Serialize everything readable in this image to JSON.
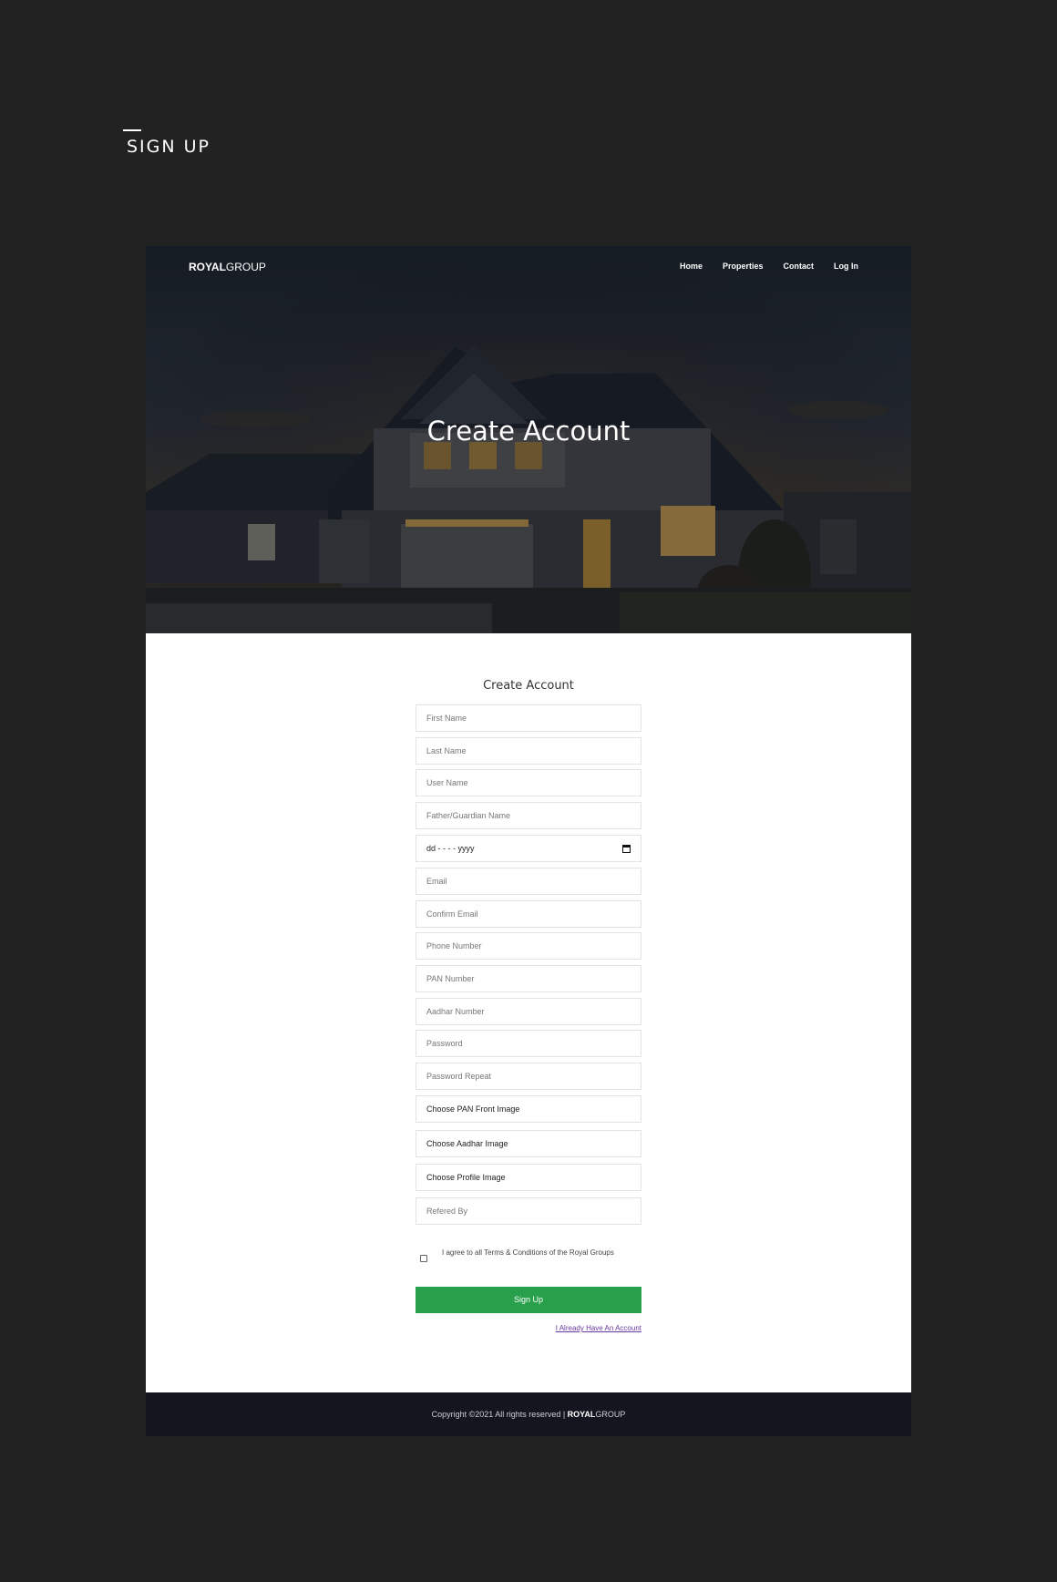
{
  "page_heading": "SIGN UP",
  "navbar": {
    "logo_bold": "ROYAL",
    "logo_light": "GROUP",
    "links": [
      "Home",
      "Properties",
      "Contact",
      "Log In"
    ]
  },
  "hero": {
    "title": "Create Account"
  },
  "form": {
    "title": "Create Account",
    "fields": {
      "first_name": "First Name",
      "last_name": "Last Name",
      "user_name": "User Name",
      "guardian_name": "Father/Guardian Name",
      "dob": "dd - - - - yyyy",
      "email": "Email",
      "confirm_email": "Confirm Email",
      "phone": "Phone Number",
      "pan": "PAN Number",
      "aadhar": "Aadhar Number",
      "password": "Password",
      "password_repeat": "Password Repeat",
      "pan_image": "Choose PAN Front Image",
      "aadhar_image": "Choose Aadhar Image",
      "profile_image": "Choose Profile Image",
      "referred_by": "Refered By"
    },
    "terms": "I agree to all Terms & Conditions of the Royal Groups",
    "submit": "Sign Up",
    "login_link": "I Already Have An Account"
  },
  "footer": {
    "text": "Copyright ©2021 All rights reserved | ",
    "brand_bold": "ROYAL",
    "brand_light": "GROUP"
  },
  "colors": {
    "page_bg": "#222222",
    "button": "#28a04b",
    "footer_bg": "#151520",
    "link": "#6b3aa0"
  }
}
